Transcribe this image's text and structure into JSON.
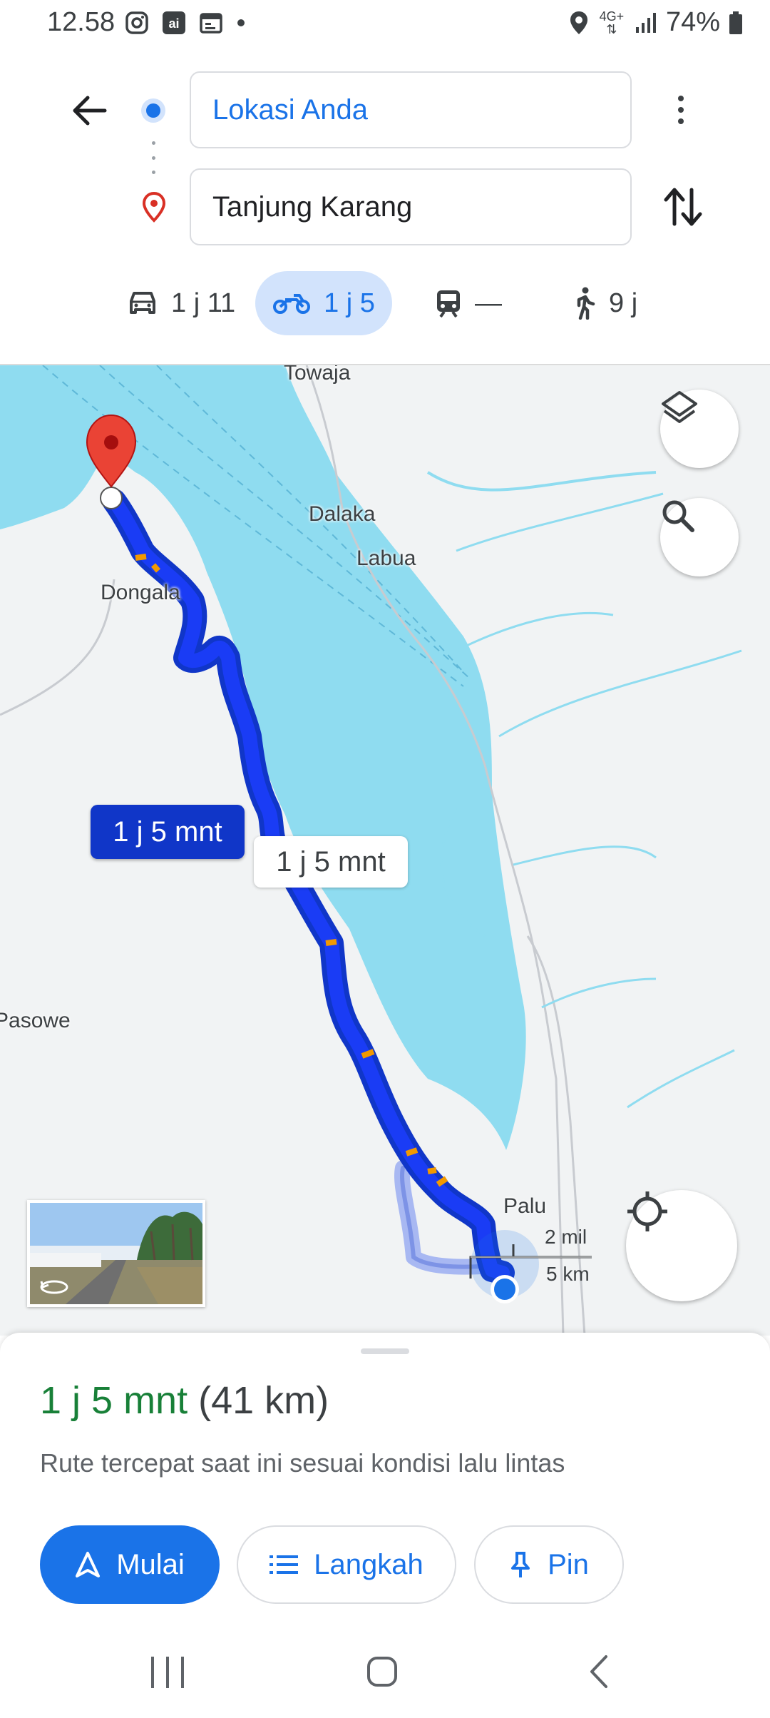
{
  "status_bar": {
    "time": "12.58",
    "network": "4G+",
    "battery": "74%",
    "icons": [
      "instagram-icon",
      "ai-app-icon",
      "calendar-icon",
      "dot-icon",
      "location-icon",
      "signal-icon",
      "battery-icon"
    ]
  },
  "header": {
    "origin": "Lokasi Anda",
    "destination": "Tanjung Karang",
    "icons": [
      "back-arrow-icon",
      "origin-dot-icon",
      "destination-pin-icon",
      "more-vert-icon",
      "swap-icon"
    ]
  },
  "modes": [
    {
      "name": "car",
      "label": "1 j 11",
      "selected": false
    },
    {
      "name": "motorcycle",
      "label": "1 j 5",
      "selected": true
    },
    {
      "name": "transit",
      "label": "—",
      "selected": false
    },
    {
      "name": "walk",
      "label": "9 j",
      "selected": false
    }
  ],
  "map": {
    "labels": {
      "towaja": "Towaja",
      "dalaka": "Dalaka",
      "labua": "Labua",
      "dongala": "Dongala",
      "pasowe": "Pasowe",
      "palu": "Palu"
    },
    "route_label_primary": "1 j 5 mnt",
    "route_label_alt": "1 j 5 mnt",
    "scale": {
      "mi": "2 mil",
      "km": "5 km"
    },
    "icons": [
      "layers-icon",
      "search-icon",
      "my-location-icon",
      "street-view-rotate-icon"
    ]
  },
  "sheet": {
    "duration": "1 j 5 mnt",
    "distance": "(41 km)",
    "description": "Rute tercepat saat ini sesuai kondisi lalu lintas",
    "buttons": {
      "start": "Mulai",
      "steps": "Langkah",
      "pin": "Pin"
    }
  },
  "colors": {
    "accent": "#1a73e8",
    "route": "#1a3cf5",
    "water": "#8fdcf0",
    "duration_green": "#188038"
  }
}
